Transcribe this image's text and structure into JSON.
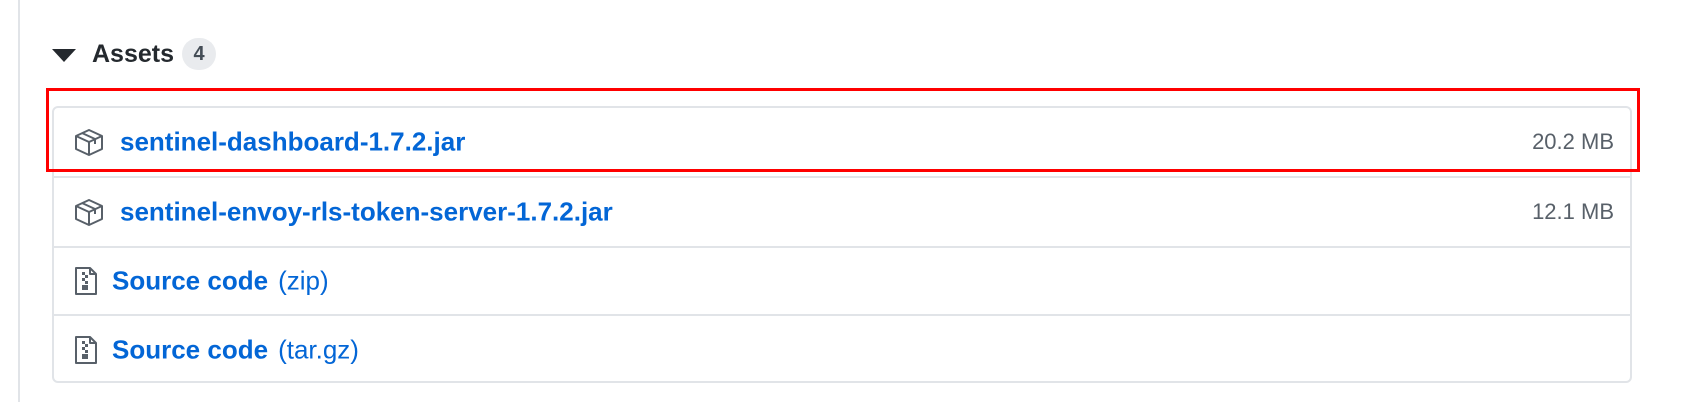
{
  "assets_section": {
    "title": "Assets",
    "count": "4"
  },
  "assets": [
    {
      "name": "sentinel-dashboard-1.7.2.jar",
      "size": "20.2 MB",
      "icon": "package-icon"
    },
    {
      "name": "sentinel-envoy-rls-token-server-1.7.2.jar",
      "size": "12.1 MB",
      "icon": "package-icon"
    }
  ],
  "source_archives": [
    {
      "label": "Source code",
      "type": "(zip)",
      "icon": "file-zip-icon"
    },
    {
      "label": "Source code",
      "type": "(tar.gz)",
      "icon": "file-zip-icon"
    }
  ],
  "colors": {
    "link": "#0366d6",
    "highlight": "#ff0000",
    "border": "#e1e4e8",
    "muted_text": "#586069"
  }
}
